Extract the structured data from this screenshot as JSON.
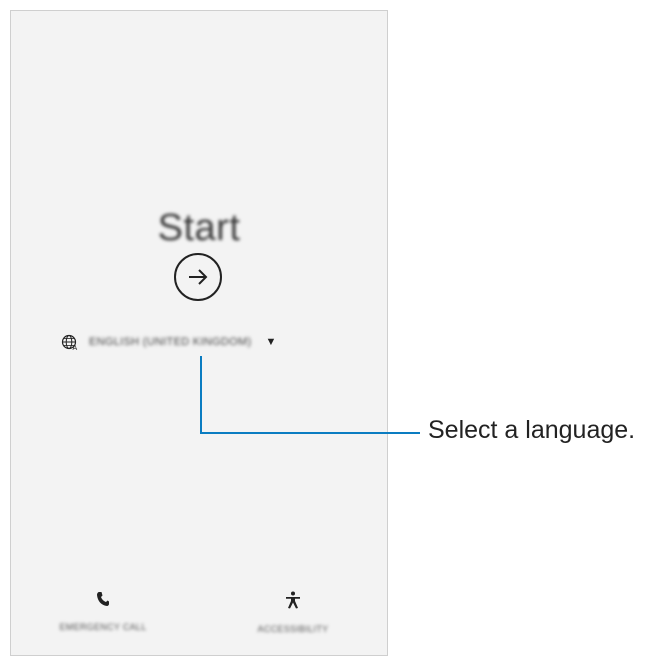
{
  "screen": {
    "title": "Start",
    "language_selector": {
      "icon": "globe-icon",
      "label": "ENGLISH (UNITED KINGDOM)",
      "dropdown_icon": "caret-down-icon"
    },
    "bottom_buttons": [
      {
        "label": "EMERGENCY CALL",
        "icon": "phone-icon"
      },
      {
        "label": "ACCESSIBILITY",
        "icon": "accessibility-icon"
      }
    ]
  },
  "callout": {
    "text": "Select a language.",
    "line_color": "#0a7cc1"
  }
}
